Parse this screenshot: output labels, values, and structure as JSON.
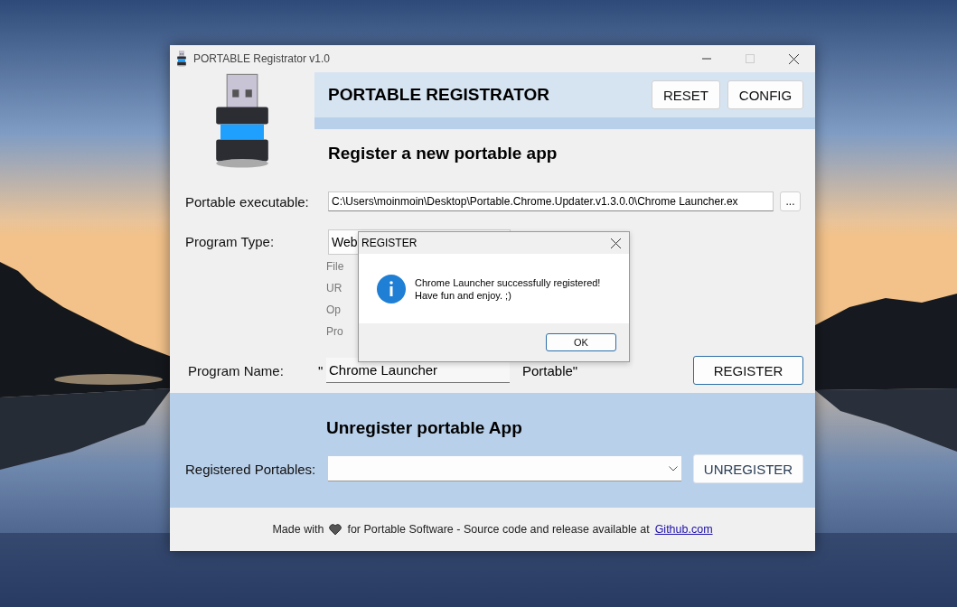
{
  "window": {
    "title": "PORTABLE Registrator v1.0"
  },
  "header": {
    "title": "PORTABLE REGISTRATOR",
    "buttons": [
      "RESET",
      "CONFIG"
    ]
  },
  "register": {
    "heading": "Register a new portable app",
    "executable": {
      "label": "Portable executable:",
      "value": "C:\\Users\\moinmoin\\Desktop\\Portable.Chrome.Updater.v1.3.0.0\\Chrome Launcher.ex",
      "browse": "..."
    },
    "program_type": {
      "label": "Program Type:",
      "value": "Web",
      "options": [
        "File",
        "UR",
        "Op",
        "Pro"
      ]
    },
    "program_name": {
      "label": "Program Name:",
      "prefix": "\"",
      "value": "Chrome Launcher",
      "suffix": "Portable\""
    },
    "button": "REGISTER"
  },
  "unregister": {
    "heading": "Unregister portable App",
    "label": "Registered Portables:",
    "button": "UNREGISTER"
  },
  "footer": {
    "before": "Made with",
    "after": "for Portable Software - Source code and release available at",
    "link": "Github.com"
  },
  "dialog": {
    "title": "REGISTER",
    "message": [
      "Chrome Launcher successfully registered!",
      "Have fun and enjoy. ;)"
    ],
    "button": "OK"
  }
}
